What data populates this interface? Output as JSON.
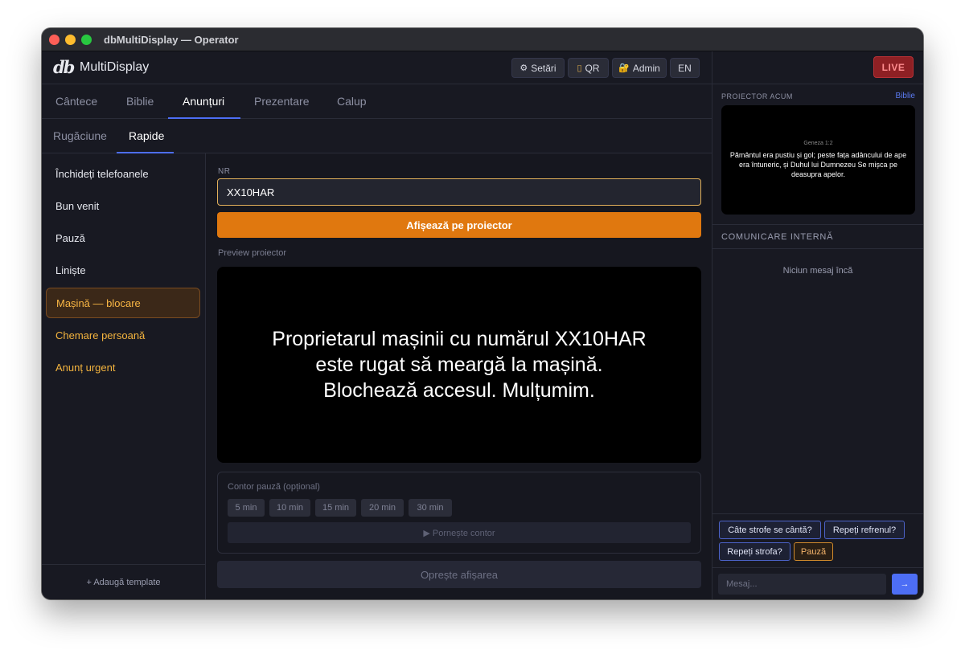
{
  "window": {
    "title": "dbMultiDisplay — Operator"
  },
  "header": {
    "logo": "db",
    "app_name": "MultiDisplay",
    "settings_label": "Setări",
    "qr_label": "QR",
    "admin_label": "Admin",
    "lang_label": "EN",
    "live_label": "LIVE"
  },
  "tabs": [
    "Cântece",
    "Biblie",
    "Anunțuri",
    "Prezentare",
    "Calup"
  ],
  "active_tab": "Anunțuri",
  "subtabs": [
    "Rugăciune",
    "Rapide"
  ],
  "active_subtab": "Rapide",
  "sidebar": {
    "items": [
      {
        "label": "Închideți telefoanele"
      },
      {
        "label": "Bun venit"
      },
      {
        "label": "Pauză"
      },
      {
        "label": "Liniște"
      },
      {
        "label": "Mașină — blocare"
      },
      {
        "label": "Chemare persoană"
      },
      {
        "label": "Anunț urgent"
      }
    ],
    "add_template": "+ Adaugă template"
  },
  "main": {
    "nr_label": "NR",
    "nr_value": "XX10HAR",
    "show_button": "Afișează pe proiector",
    "preview_label": "Preview proiector",
    "preview_text": "Proprietarul mașinii cu numărul XX10HAR\neste rugat să meargă la mașină.\nBlochează accesul. Mulțumim.",
    "timer_label": "Contor pauză (opțional)",
    "timer_options": [
      "5 min",
      "10 min",
      "15 min",
      "20 min",
      "30 min"
    ],
    "start_timer": "▶ Pornește contor",
    "stop_display": "Oprește afișarea"
  },
  "right_panel": {
    "projector_label": "PROIECTOR ACUM",
    "projector_source": "Biblie",
    "verse_ref": "Geneza 1:2",
    "verse_text": "Pământul era pustiu și gol; peste fața adâncului de ape era întuneric, și Duhul lui Dumnezeu Se mișca pe deasupra apelor.",
    "comm_label": "COMUNICARE INTERNĂ",
    "no_messages": "Niciun mesaj încă",
    "quick_messages": [
      "Câte strofe se cântă?",
      "Repeți refrenul?",
      "Repeți strofa?",
      "Pauză"
    ],
    "message_placeholder": "Mesaj...",
    "send_label": "→"
  },
  "colors": {
    "accent": "#4d6ef5",
    "primary_action": "#e0780f",
    "live": "#8e2024",
    "warning_text": "#f4b43e"
  }
}
